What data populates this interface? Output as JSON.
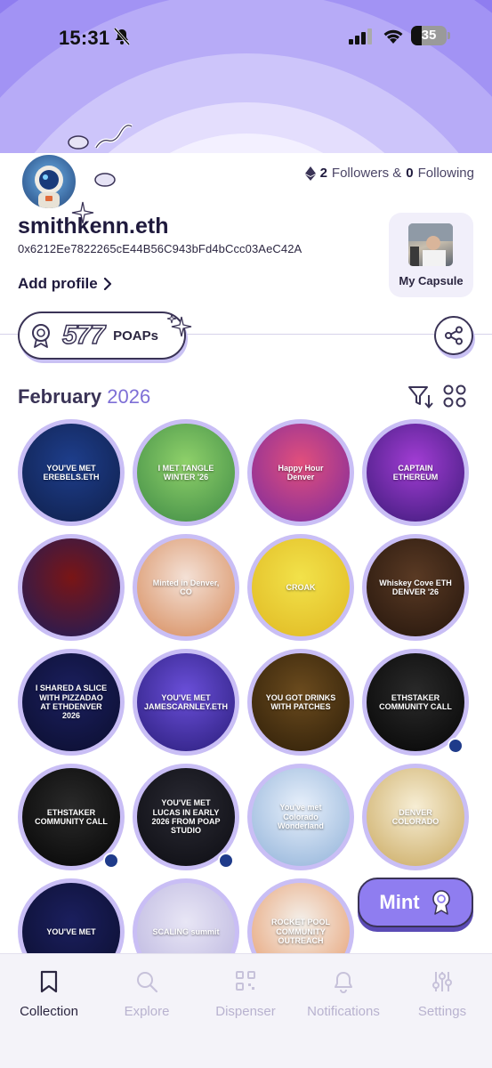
{
  "status_bar": {
    "time": "15:31",
    "battery": "35"
  },
  "profile": {
    "followers_count": "2",
    "followers_label": "Followers &",
    "following_count": "0",
    "following_label": "Following",
    "username": "smithkenn.eth",
    "address": "0x6212Ee7822265cE44B56C943bFd4bCcc03AeC42A",
    "add_profile_label": "Add profile",
    "capsule_label": "My Capsule"
  },
  "poap_summary": {
    "count": "577",
    "unit": "POAPs"
  },
  "section": {
    "month": "February",
    "year": "2026"
  },
  "poaps": [
    {
      "text": "YOU'VE MET EREBELS.ETH",
      "color_from": "#1e3e8c",
      "color_to": "#0f1f4a"
    },
    {
      "text": "I MET TANGLE WINTER '26",
      "color_from": "#8fd16a",
      "color_to": "#3e8a45"
    },
    {
      "text": "Happy Hour Denver",
      "color_from": "#e24f7c",
      "color_to": "#7a2a9e"
    },
    {
      "text": "CAPTAIN ETHEREUM",
      "color_from": "#a23dd4",
      "color_to": "#3b1a78"
    },
    {
      "text": "",
      "color_from": "#7a1515",
      "color_to": "#1c1d5c"
    },
    {
      "text": "Minted in Denver, CO",
      "color_from": "#f4e1d6",
      "color_to": "#d68a5a"
    },
    {
      "text": "CROAK",
      "color_from": "#f2e24a",
      "color_to": "#e0b822"
    },
    {
      "text": "Whiskey Cove ETH DENVER '26",
      "color_from": "#5a3a24",
      "color_to": "#24150c"
    },
    {
      "text": "I SHARED A SLICE WITH PIZZADAO AT ETHDENVER 2026",
      "color_from": "#1b1f5e",
      "color_to": "#0b0e2e"
    },
    {
      "text": "YOU'VE MET JAMESCARNLEY.ETH",
      "color_from": "#6a4fd9",
      "color_to": "#2a1d7a"
    },
    {
      "text": "YOU GOT DRINKS WITH PATCHES",
      "color_from": "#6b4b1e",
      "color_to": "#2e1e08"
    },
    {
      "text": "ETHSTAKER COMMUNITY CALL",
      "color_from": "#2a2a2a",
      "color_to": "#050505"
    },
    {
      "text": "ETHSTAKER COMMUNITY CALL",
      "color_from": "#2a2a2a",
      "color_to": "#050505"
    },
    {
      "text": "YOU'VE MET LUCAS IN EARLY 2026 FROM POAP STUDIO",
      "color_from": "#2a2a33",
      "color_to": "#0c0c12"
    },
    {
      "text": "You've met Colorado Wonderland",
      "color_from": "#e8f0fb",
      "color_to": "#8fb1d8"
    },
    {
      "text": "DENVER COLORADO",
      "color_from": "#f7eed5",
      "color_to": "#c9a85e"
    },
    {
      "text": "YOU'VE MET",
      "color_from": "#1b1f5e",
      "color_to": "#0b0e2e"
    },
    {
      "text": "SCALING summit",
      "color_from": "#e8e6f5",
      "color_to": "#b9b3de"
    },
    {
      "text": "ROCKET POOL COMMUNITY OUTREACH",
      "color_from": "#f4f1ec",
      "color_to": "#e69a6a"
    }
  ],
  "mint_label": "Mint",
  "tabs": [
    {
      "label": "Collection"
    },
    {
      "label": "Explore"
    },
    {
      "label": "Dispenser"
    },
    {
      "label": "Notifications"
    },
    {
      "label": "Settings"
    }
  ]
}
